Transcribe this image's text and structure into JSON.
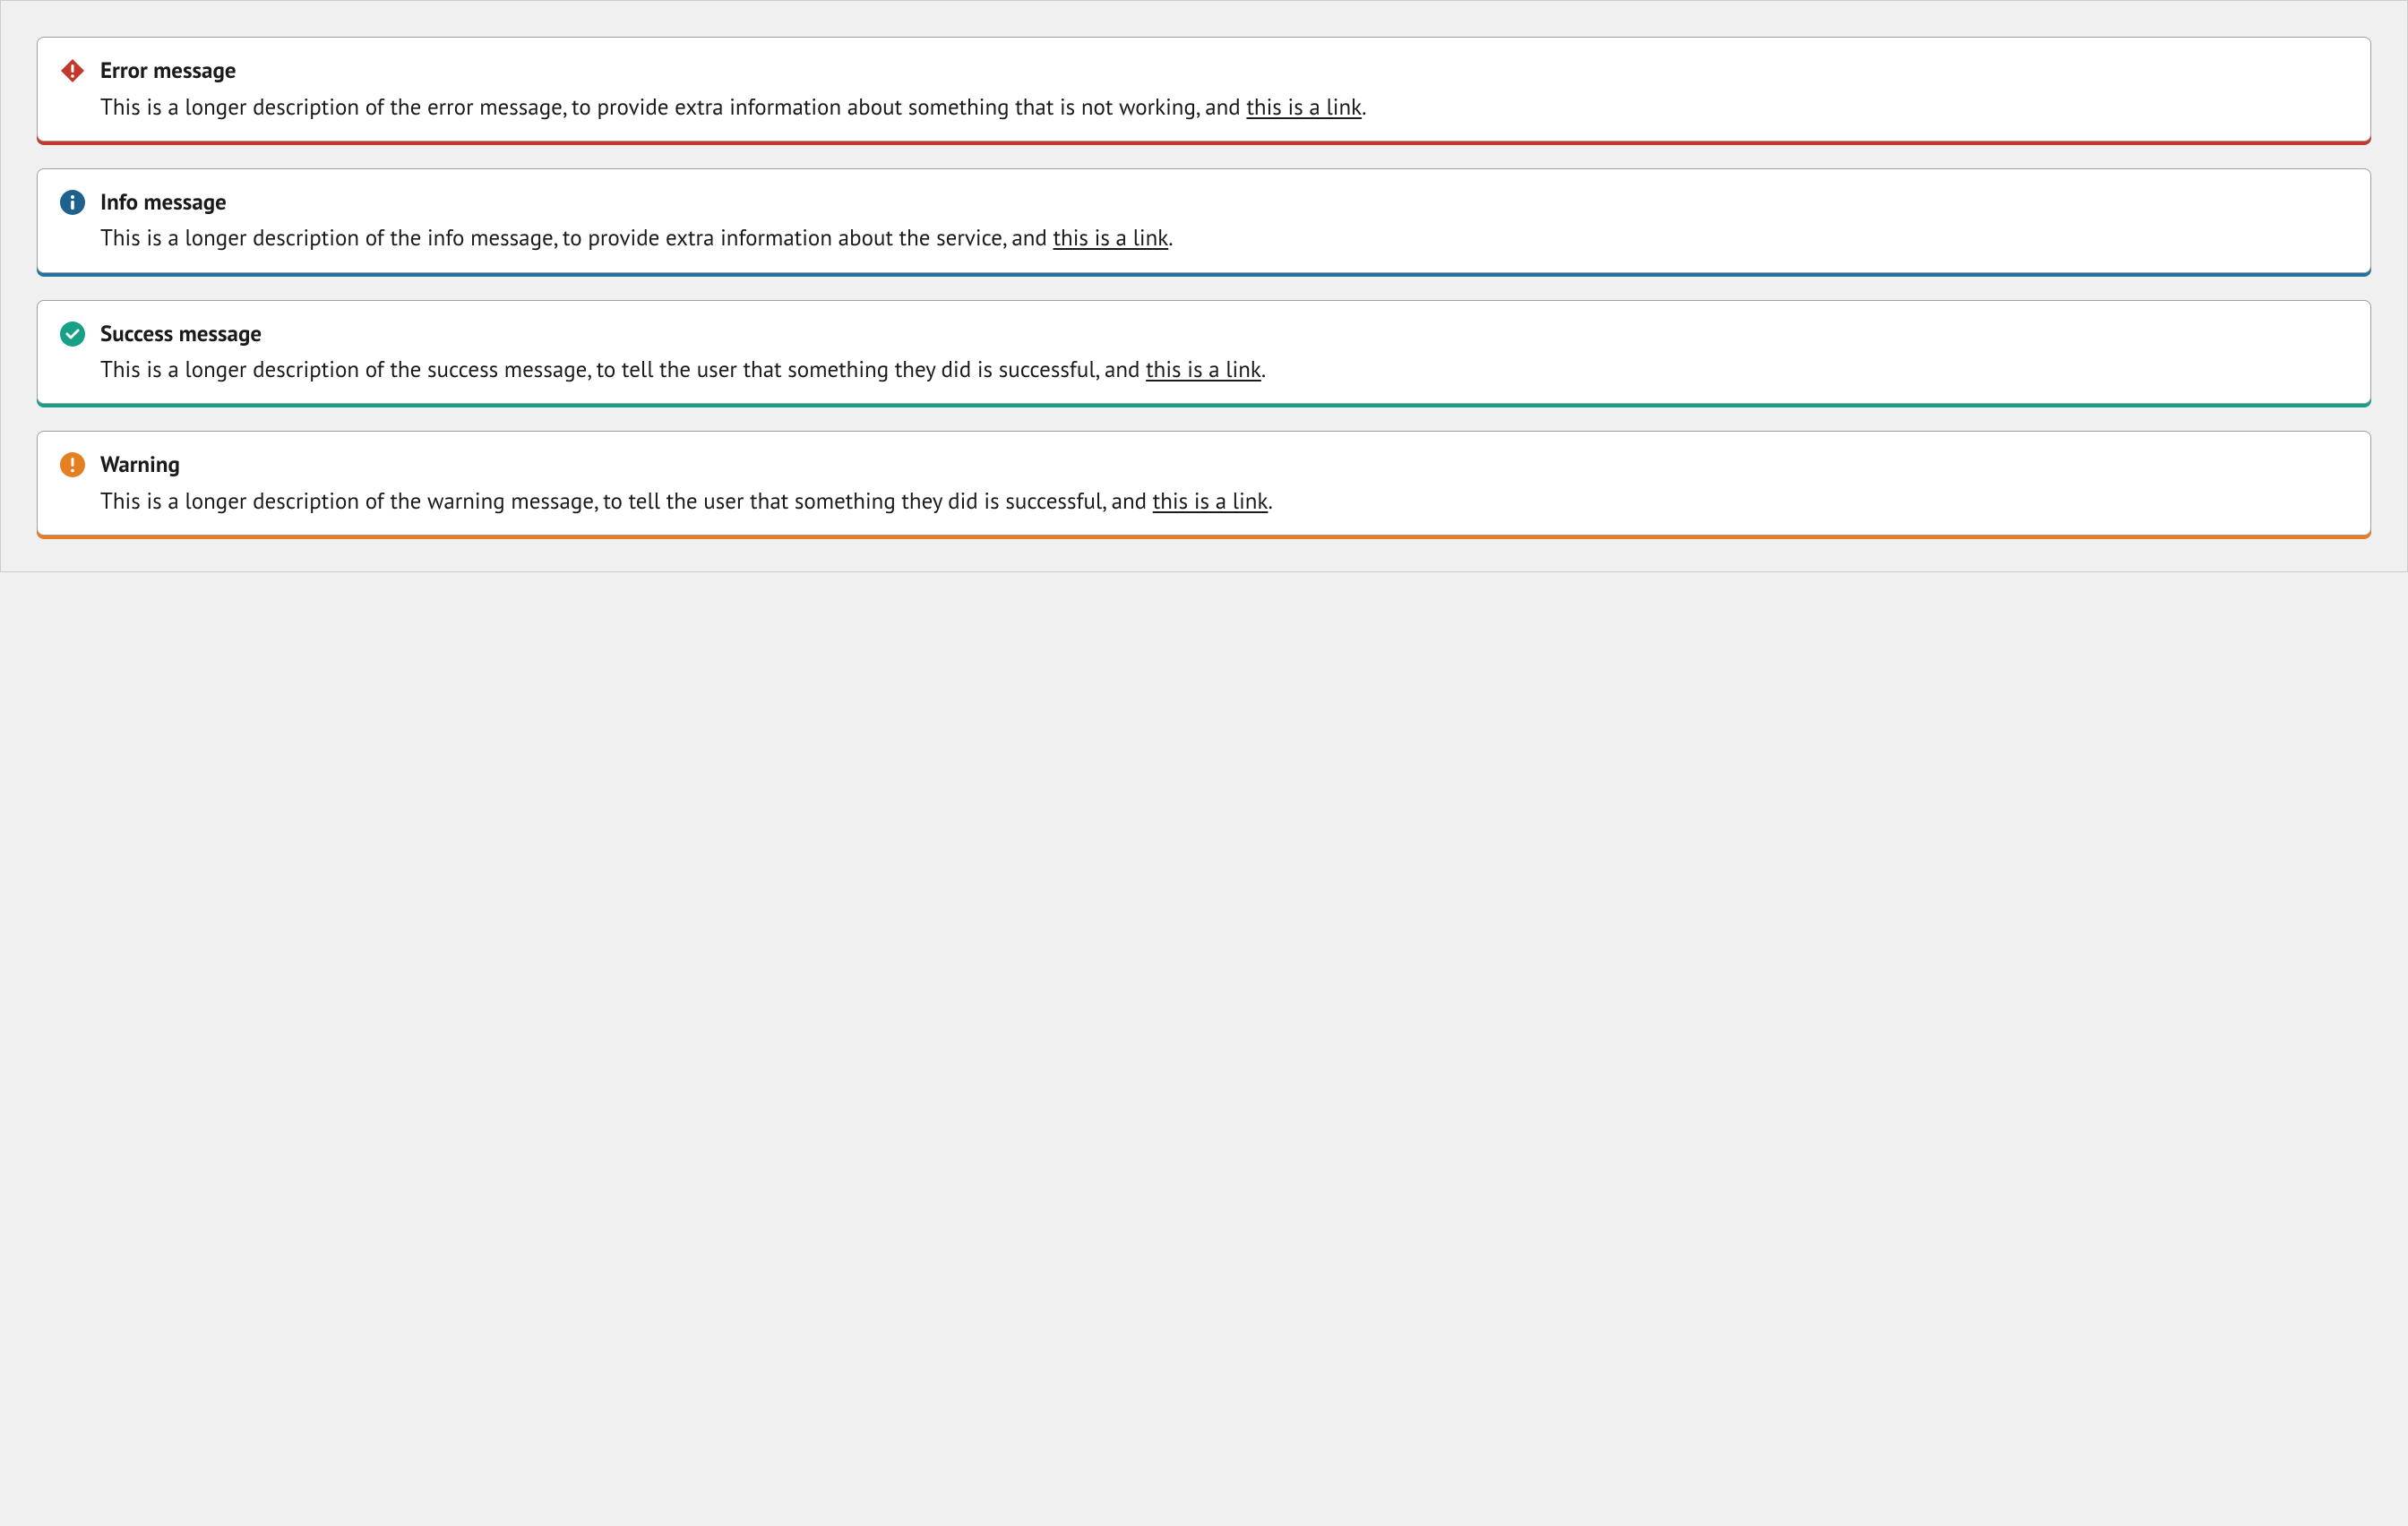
{
  "alerts": [
    {
      "type": "error",
      "heading": "Error message",
      "description_before": "This is a longer description of the error message, to provide extra information about something that is not working, and ",
      "link_text": "this is a link",
      "description_after": ".",
      "icon_color": "#c0392b",
      "accent_color": "#c0392b"
    },
    {
      "type": "info",
      "heading": "Info message",
      "description_before": "This is a longer description of the info message, to provide extra information about the service, and ",
      "link_text": "this is a link",
      "description_after": ".",
      "icon_color": "#1f618d",
      "accent_color": "#2471a3"
    },
    {
      "type": "success",
      "heading": "Success message",
      "description_before": "This is a longer description of the success message, to tell the user that something they did is successful, and ",
      "link_text": "this is a link",
      "description_after": ".",
      "icon_color": "#16a085",
      "accent_color": "#16a085"
    },
    {
      "type": "warning",
      "heading": "Warning",
      "description_before": "This is a longer description of the warning message, to tell the user that something they did is successful, and ",
      "link_text": "this is a link",
      "description_after": ".",
      "icon_color": "#e67e22",
      "accent_color": "#e67e22"
    }
  ]
}
